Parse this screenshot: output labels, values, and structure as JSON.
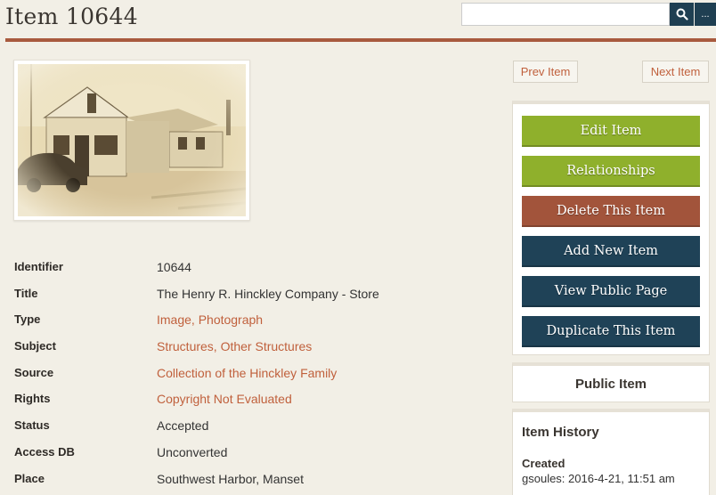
{
  "page": {
    "title": "Item 10644"
  },
  "search": {
    "placeholder": "",
    "more_label": "..."
  },
  "nav": {
    "prev_label": "Prev Item",
    "next_label": "Next Item"
  },
  "actions": [
    {
      "label": "Edit Item",
      "color": "#8fb02c"
    },
    {
      "label": "Relationships",
      "color": "#8fb02c"
    },
    {
      "label": "Delete This Item",
      "color": "#a2543b"
    },
    {
      "label": "Add New Item",
      "color": "#1f4257"
    },
    {
      "label": "View Public Page",
      "color": "#1f4257"
    },
    {
      "label": "Duplicate This Item",
      "color": "#1f4257"
    }
  ],
  "public_status": "Public Item",
  "history": {
    "title": "Item History",
    "created_label": "Created",
    "created_value": "gsoules: 2016-4-21, 11:51 am"
  },
  "metadata": [
    {
      "label": "Identifier",
      "value": "10644"
    },
    {
      "label": "Title",
      "value": "The Henry R. Hinckley Company - Store"
    },
    {
      "label": "Type",
      "value": "Image, Photograph"
    },
    {
      "label": "Subject",
      "value": "Structures, Other Structures"
    },
    {
      "label": "Source",
      "value": "Collection of the Hinckley Family"
    },
    {
      "label": "Rights",
      "value": "Copyright Not Evaluated"
    },
    {
      "label": "Status",
      "value": "Accepted"
    },
    {
      "label": "Access DB",
      "value": "Unconverted"
    },
    {
      "label": "Place",
      "value": "Southwest Harbor, Manset"
    }
  ],
  "colors": {
    "accent_rule": "#a85a3e",
    "link": "#c0603c",
    "navy": "#1f3f52"
  }
}
